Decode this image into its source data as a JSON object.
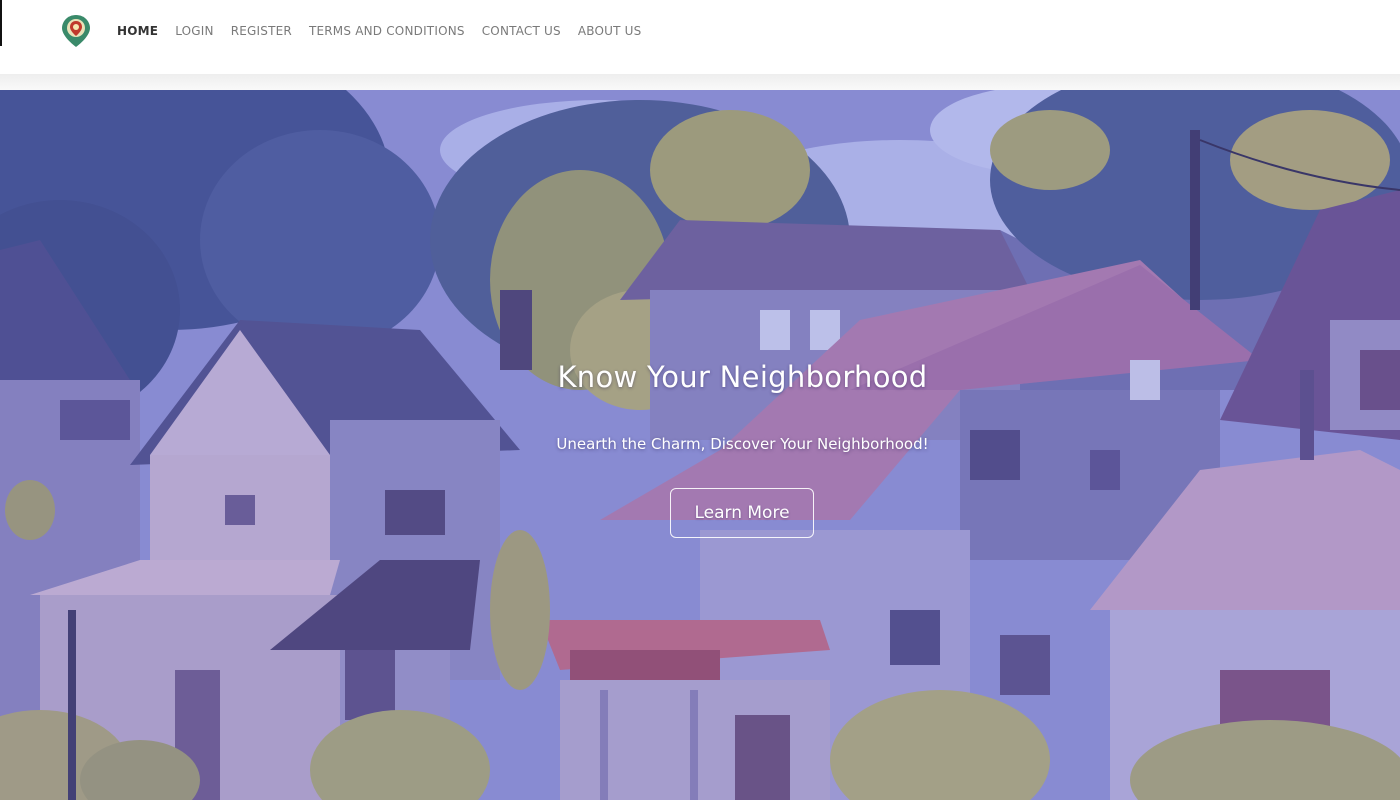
{
  "navbar": {
    "logo_icon": "map-pin-logo-icon",
    "links": [
      {
        "label": "HOME",
        "active": true
      },
      {
        "label": "LOGIN",
        "active": false
      },
      {
        "label": "REGISTER",
        "active": false
      },
      {
        "label": "TERMS AND CONDITIONS",
        "active": false
      },
      {
        "label": "CONTACT US",
        "active": false
      },
      {
        "label": "ABOUT US",
        "active": false
      }
    ]
  },
  "hero": {
    "title": "Know Your Neighborhood",
    "subtitle": "Unearth the Charm, Discover Your Neighborhood!",
    "button_label": "Learn More",
    "background": "illustrated-neighborhood-houses-image"
  },
  "colors": {
    "nav_active": "#333333",
    "nav_link": "#7a7a7a",
    "hero_overlay": "#7e80c6",
    "hero_text": "#ffffff"
  }
}
